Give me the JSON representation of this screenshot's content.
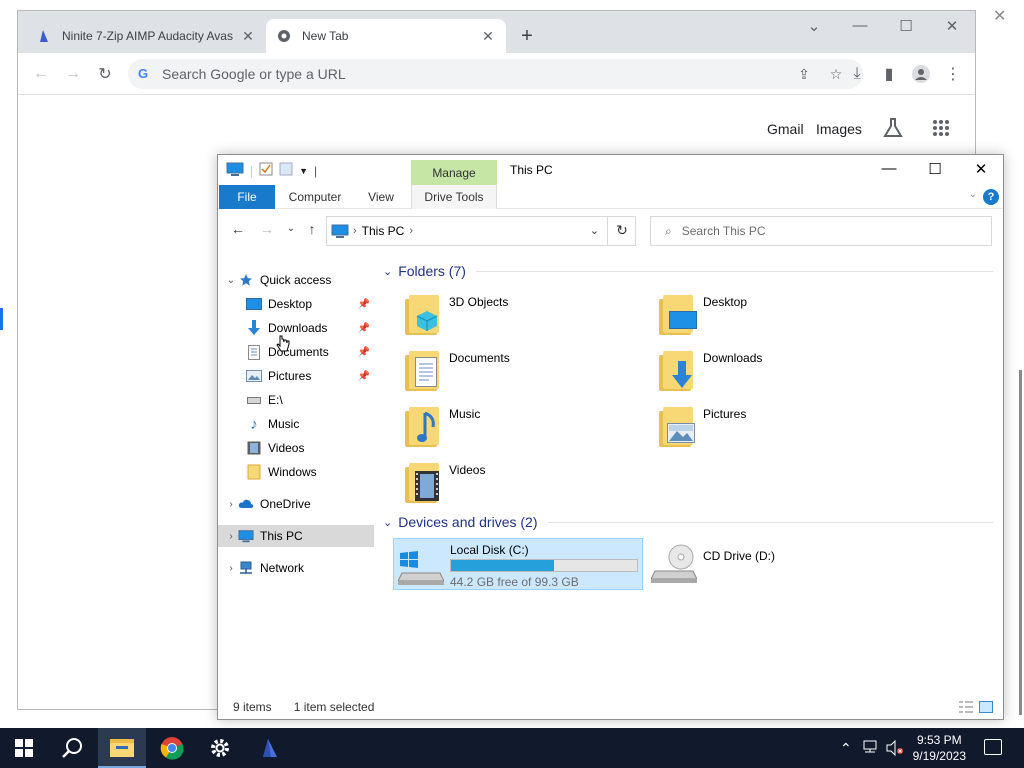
{
  "chrome": {
    "tabs": [
      {
        "title": "Ninite 7-Zip AIMP Audacity Avas"
      },
      {
        "title": "New Tab"
      }
    ],
    "omnibox_placeholder": "Search Google or type a URL",
    "links": {
      "gmail": "Gmail",
      "images": "Images"
    }
  },
  "explorer": {
    "window_title": "This PC",
    "ribbon": {
      "manage": "Manage",
      "tabs": [
        "File",
        "Computer",
        "View",
        "Drive Tools"
      ]
    },
    "address": {
      "crumb": "This PC"
    },
    "search_placeholder": "Search This PC",
    "nav": {
      "quick_access": "Quick access",
      "items": [
        "Desktop",
        "Downloads",
        "Documents",
        "Pictures",
        "E:\\",
        "Music",
        "Videos",
        "Windows"
      ],
      "onedrive": "OneDrive",
      "thispc": "This PC",
      "network": "Network"
    },
    "groups": {
      "folders": "Folders (7)",
      "devices": "Devices and drives (2)"
    },
    "folders": [
      "3D Objects",
      "Desktop",
      "Documents",
      "Downloads",
      "Music",
      "Pictures",
      "Videos"
    ],
    "drives": [
      {
        "name": "Local Disk (C:)",
        "free": "44.2 GB free of 99.3 GB",
        "used_fraction": 0.555
      },
      {
        "name": "CD Drive (D:)"
      }
    ],
    "status": {
      "items": "9 items",
      "selected": "1 item selected"
    }
  },
  "taskbar": {
    "time": "9:53 PM",
    "date": "9/19/2023"
  },
  "colors": {
    "accent": "#1979ca",
    "selection": "#cce8ff",
    "manage_tab": "#c5e6a5",
    "group_header": "#1e3287",
    "taskbar": "#101a2c"
  }
}
